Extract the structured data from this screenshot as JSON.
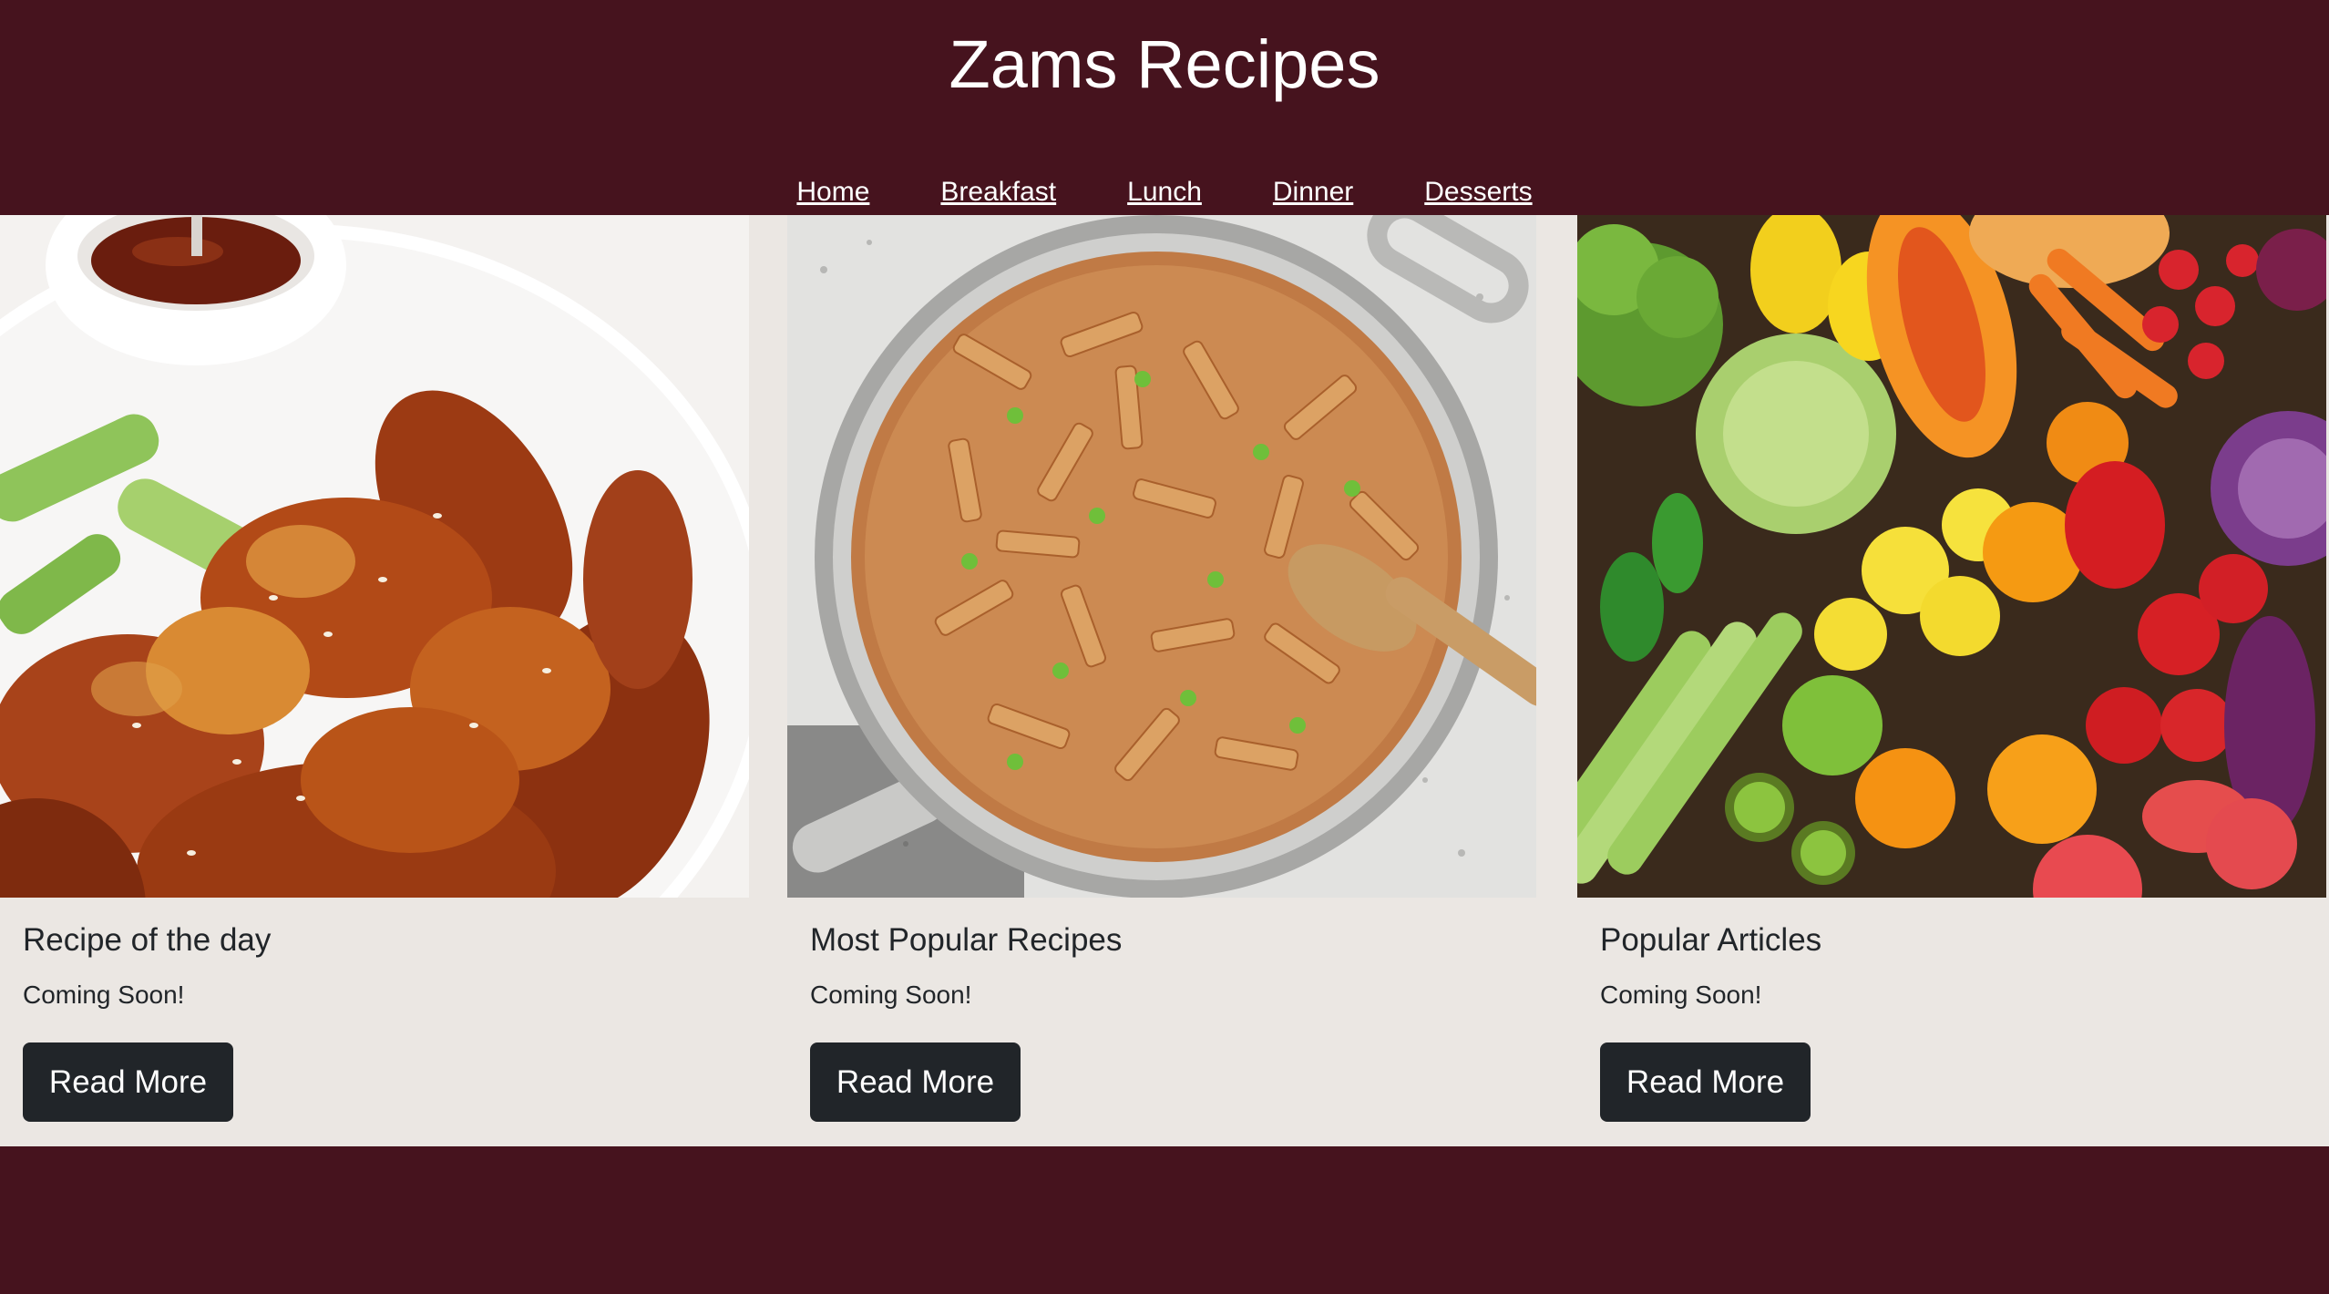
{
  "site": {
    "title": "Zams Recipes"
  },
  "nav": {
    "items": [
      {
        "label": "Home"
      },
      {
        "label": "Breakfast"
      },
      {
        "label": "Lunch"
      },
      {
        "label": "Dinner"
      },
      {
        "label": "Desserts"
      }
    ]
  },
  "cards": [
    {
      "title": "Recipe of the day",
      "text": "Coming Soon!",
      "button_label": "Read More",
      "image": "glazed-chicken-wings-photo"
    },
    {
      "title": "Most Popular Recipes",
      "text": "Coming Soon!",
      "button_label": "Read More",
      "image": "penne-pasta-skillet-photo"
    },
    {
      "title": "Popular Articles",
      "text": "Coming Soon!",
      "button_label": "Read More",
      "image": "fresh-vegetables-fruits-photo"
    }
  ],
  "colors": {
    "header_bg": "#46131e",
    "content_bg": "#ebe7e3",
    "button_bg": "#212529",
    "text": "#212529"
  }
}
